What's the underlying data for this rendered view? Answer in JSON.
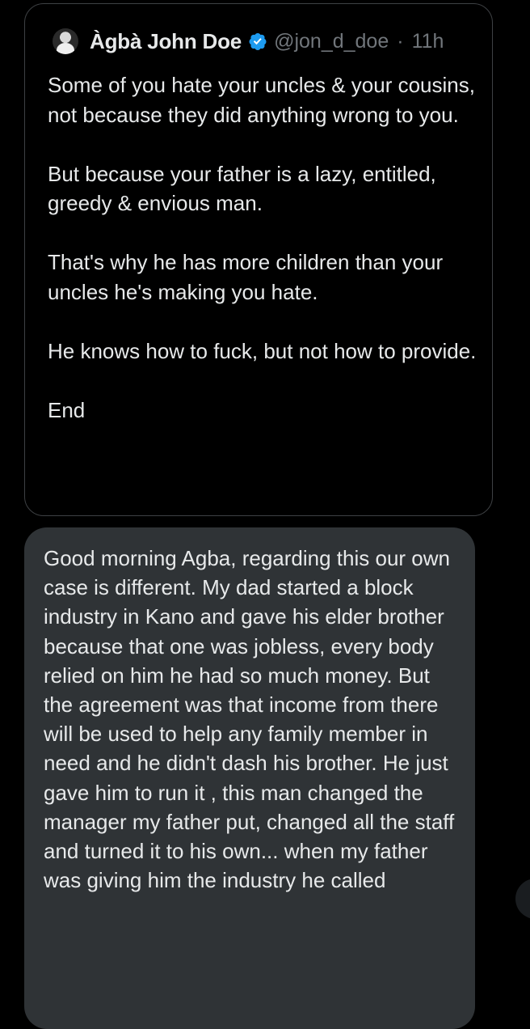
{
  "quoted_post": {
    "author_name": "Àgbà John Doe",
    "handle": "@jon_d_doe",
    "separator": "·",
    "time": "11h",
    "verified_color": "#1d9bf0",
    "body": "Some of you hate your uncles & your cousins, not because they did anything wrong to you.\n\nBut because your father is a lazy, entitled, greedy & envious man.\n\nThat's why he has more children than your uncles he's making you hate.\n\nHe knows how to fuck, but not how to provide.\n\nEnd"
  },
  "reply": {
    "text": "Good morning Agba, regarding this our own case is different. My dad started a block industry in Kano and gave his elder brother because that one was jobless, every body relied on him he had so much money. But the agreement was that income from there will be used to help any family member in need and he didn't dash his brother. He just gave him to run it , this man changed the manager my father put, changed all the staff and turned it to his own... when my  father was giving him the industry he called"
  },
  "colors": {
    "background": "#000000",
    "card_border": "#3e4144",
    "bubble": "#2f3336",
    "primary_text": "#e7e9ea",
    "secondary_text": "#71767b"
  }
}
